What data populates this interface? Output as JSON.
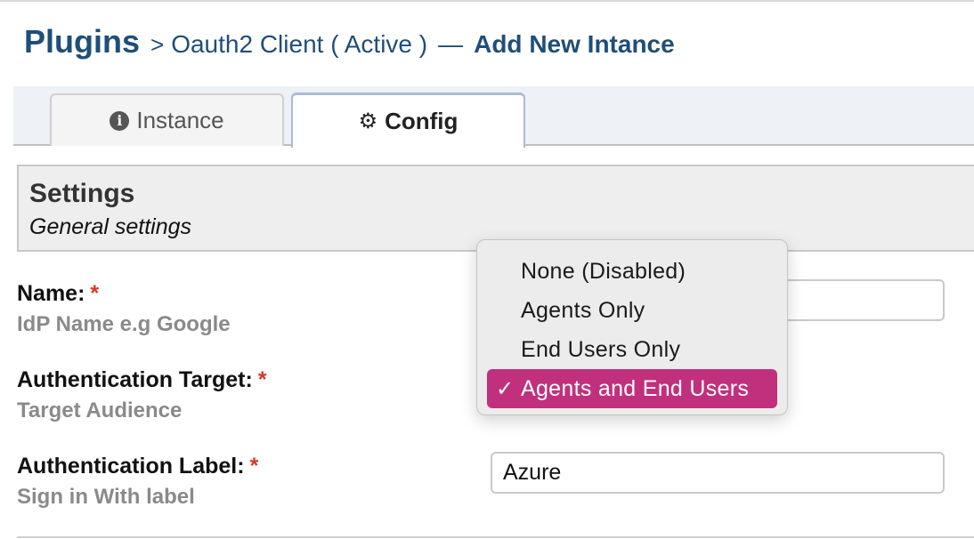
{
  "header": {
    "root": "Plugins",
    "separator": ">",
    "plugin": "Oauth2 Client ( Active )",
    "dash": "—",
    "current": "Add New Intance"
  },
  "tabs": [
    {
      "label": "Instance",
      "icon": "info-circle-icon",
      "active": false
    },
    {
      "label": "Config",
      "icon": "gear-icon",
      "active": true
    }
  ],
  "settings": {
    "title": "Settings",
    "subtitle": "General settings"
  },
  "fields": {
    "name": {
      "label": "Name:",
      "required_mark": "*",
      "hint": "IdP Name e.g Google",
      "value": ""
    },
    "auth_target": {
      "label": "Authentication Target:",
      "required_mark": "*",
      "hint": "Target Audience"
    },
    "auth_label": {
      "label": "Authentication Label:",
      "required_mark": "*",
      "hint": "Sign in With label",
      "value": "Azure"
    }
  },
  "dropdown": {
    "options": [
      "None (Disabled)",
      "Agents Only",
      "End Users Only",
      "Agents and End Users"
    ],
    "selected": "Agents and End Users",
    "check_glyph": "✓",
    "selected_color": "#c1307d"
  },
  "colors": {
    "heading": "#1f4e79",
    "required": "#d9362b",
    "hint": "#8a8a8a"
  }
}
